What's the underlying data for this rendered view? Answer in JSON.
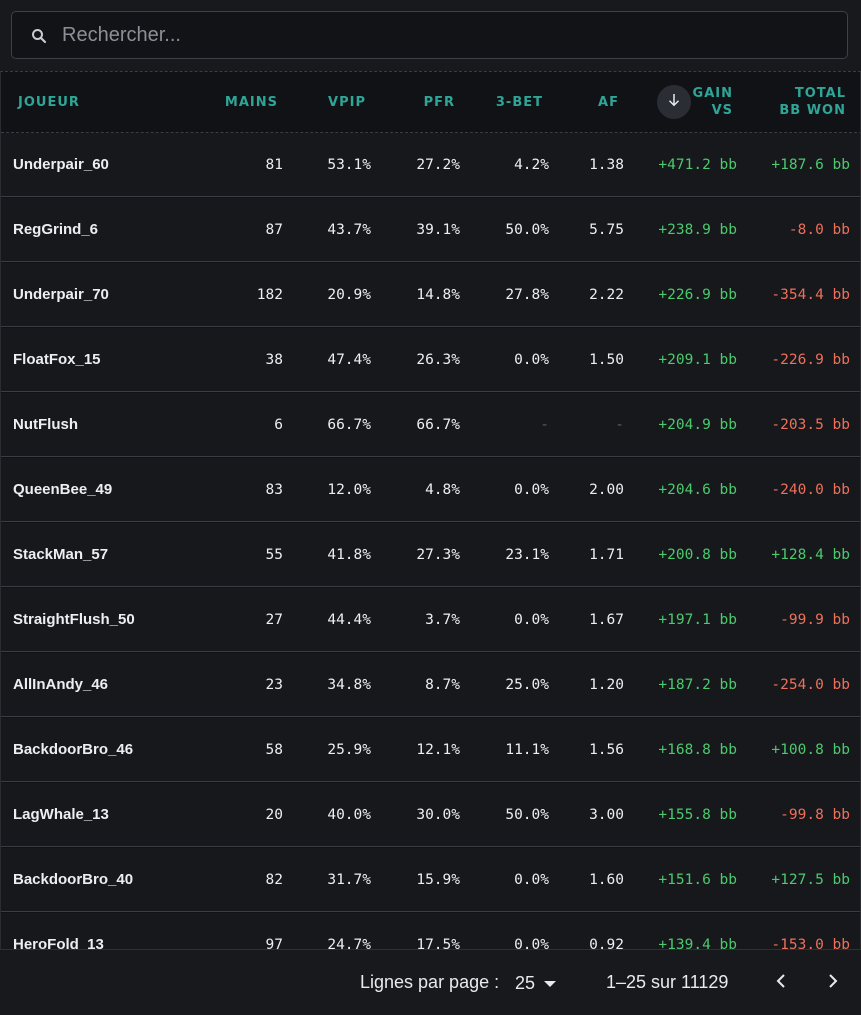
{
  "search": {
    "placeholder": "Rechercher...",
    "icon": "search-icon"
  },
  "table": {
    "columns": {
      "player": "JOUEUR",
      "hands": "MAINS",
      "vpip": "VPIP",
      "pfr": "PFR",
      "three_bet": "3-BET",
      "af": "AF",
      "gain_vs_line1": "GAIN",
      "gain_vs_line2": "VS",
      "total_line1": "TOTAL",
      "total_line2": "BB WON"
    },
    "sort_icon": "arrow-down-icon",
    "rows": [
      {
        "player": "Underpair_60",
        "hands": "81",
        "vpip": "53.1%",
        "pfr": "27.2%",
        "three_bet": "4.2%",
        "af": "1.38",
        "gain_vs": "+471.2 bb",
        "total": "+187.6 bb"
      },
      {
        "player": "RegGrind_6",
        "hands": "87",
        "vpip": "43.7%",
        "pfr": "39.1%",
        "three_bet": "50.0%",
        "af": "5.75",
        "gain_vs": "+238.9 bb",
        "total": "-8.0 bb"
      },
      {
        "player": "Underpair_70",
        "hands": "182",
        "vpip": "20.9%",
        "pfr": "14.8%",
        "three_bet": "27.8%",
        "af": "2.22",
        "gain_vs": "+226.9 bb",
        "total": "-354.4 bb"
      },
      {
        "player": "FloatFox_15",
        "hands": "38",
        "vpip": "47.4%",
        "pfr": "26.3%",
        "three_bet": "0.0%",
        "af": "1.50",
        "gain_vs": "+209.1 bb",
        "total": "-226.9 bb"
      },
      {
        "player": "NutFlush",
        "hands": "6",
        "vpip": "66.7%",
        "pfr": "66.7%",
        "three_bet": "-",
        "af": "-",
        "gain_vs": "+204.9 bb",
        "total": "-203.5 bb"
      },
      {
        "player": "QueenBee_49",
        "hands": "83",
        "vpip": "12.0%",
        "pfr": "4.8%",
        "three_bet": "0.0%",
        "af": "2.00",
        "gain_vs": "+204.6 bb",
        "total": "-240.0 bb"
      },
      {
        "player": "StackMan_57",
        "hands": "55",
        "vpip": "41.8%",
        "pfr": "27.3%",
        "three_bet": "23.1%",
        "af": "1.71",
        "gain_vs": "+200.8 bb",
        "total": "+128.4 bb"
      },
      {
        "player": "StraightFlush_50",
        "hands": "27",
        "vpip": "44.4%",
        "pfr": "3.7%",
        "three_bet": "0.0%",
        "af": "1.67",
        "gain_vs": "+197.1 bb",
        "total": "-99.9 bb"
      },
      {
        "player": "AllInAndy_46",
        "hands": "23",
        "vpip": "34.8%",
        "pfr": "8.7%",
        "three_bet": "25.0%",
        "af": "1.20",
        "gain_vs": "+187.2 bb",
        "total": "-254.0 bb"
      },
      {
        "player": "BackdoorBro_46",
        "hands": "58",
        "vpip": "25.9%",
        "pfr": "12.1%",
        "three_bet": "11.1%",
        "af": "1.56",
        "gain_vs": "+168.8 bb",
        "total": "+100.8 bb"
      },
      {
        "player": "LagWhale_13",
        "hands": "20",
        "vpip": "40.0%",
        "pfr": "30.0%",
        "three_bet": "50.0%",
        "af": "3.00",
        "gain_vs": "+155.8 bb",
        "total": "-99.8 bb"
      },
      {
        "player": "BackdoorBro_40",
        "hands": "82",
        "vpip": "31.7%",
        "pfr": "15.9%",
        "three_bet": "0.0%",
        "af": "1.60",
        "gain_vs": "+151.6 bb",
        "total": "+127.5 bb"
      },
      {
        "player": "HeroFold_13",
        "hands": "97",
        "vpip": "24.7%",
        "pfr": "17.5%",
        "three_bet": "0.0%",
        "af": "0.92",
        "gain_vs": "+139.4 bb",
        "total": "-153.0 bb"
      }
    ]
  },
  "pagination": {
    "rows_per_page_label": "Lignes par page :",
    "rows_per_page_value": "25",
    "range_text": "1–25 sur 11129",
    "prev_icon": "chevron-left-icon",
    "next_icon": "chevron-right-icon"
  },
  "colors": {
    "accent": "#2fa597",
    "positive": "#4cc96d",
    "negative": "#ee6f5a",
    "background": "#17191d"
  }
}
